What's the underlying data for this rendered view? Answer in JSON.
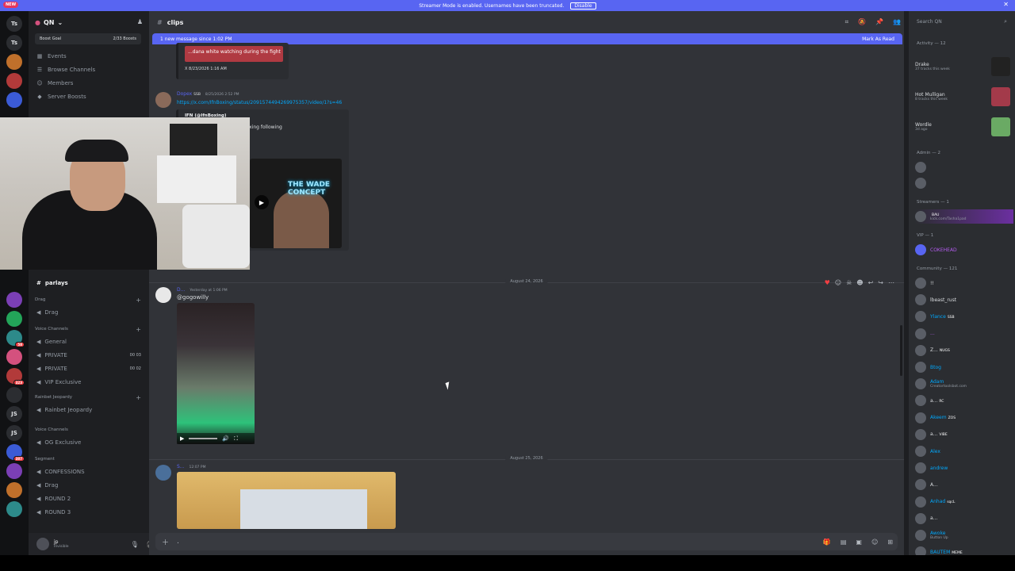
{
  "banner": {
    "text": "Streamer Mode is enabled. Usernames have been truncated.",
    "button": "Disable",
    "new_badge": "NEW"
  },
  "server": {
    "name": "QN",
    "boost_goal": "Boost Goal",
    "boost_count": "2/33 Boosts"
  },
  "server_rail": [
    "Ts",
    "Ts",
    "JS",
    "JS"
  ],
  "nav": {
    "events": "Events",
    "browse": "Browse Channels",
    "members": "Members",
    "boosts": "Server Boosts"
  },
  "channels": {
    "parlays": "parlays",
    "cat_drag": "Drag",
    "drag": "Drag",
    "cat_voice": "Voice Channels",
    "general": "General",
    "private1": "PRIVATE",
    "private1_cnt": "00  03",
    "private2": "PRIVATE",
    "private2_cnt": "00  02",
    "vip": "VIP Exclusive",
    "cat_rainbet": "Rainbet Jeopardy",
    "rainbet": "Rainbet Jeopardy",
    "cat_voice2": "Voice Channels",
    "og": "OG Exclusive",
    "cat_segment": "Segment",
    "confessions": "CONFESSIONS",
    "drag2": "Drag",
    "round2": "ROUND 2",
    "round3": "ROUND 3"
  },
  "user": {
    "name": "jp",
    "status": "Invisible"
  },
  "chat": {
    "channel": "clips",
    "new_message": "1 new message since 1:02 PM",
    "mark_read": "Mark As Read",
    "embed1_text": "...dana white watching during the fight",
    "embed1_meta": "X  8/23/2026 1:16 AM",
    "msg1_user": "Dopex",
    "msg1_tag": "SSB",
    "msg1_time": "8/25/2026 2:52 PM",
    "msg1_link": "https://x.com/IfnBoxing/status/2091574494269975357/video/1?s=46",
    "embed2_author": "IFN (@IfnBoxing)",
    "embed2_text": "...mperrr will retire from boxing following",
    "embed2_video_title": "THE WADE CONCEPT",
    "date1": "August 24, 2026",
    "msg2_user": "D...",
    "msg2_time": "Yesterday at 1:06 PM",
    "msg2_text": "@gogowilly",
    "date2": "August 25, 2026",
    "msg3_user": "S...",
    "msg3_time": "12:07 PM",
    "input_placeholder": "."
  },
  "members": {
    "search": "Search QN",
    "activity_header": "Activity — 12",
    "activities": [
      {
        "name": "Drake",
        "sub": "37 tracks this week"
      },
      {
        "name": "Hot Mulligan",
        "sub": "8 tracks this week"
      },
      {
        "name": "Wordle",
        "sub": "3d ago"
      }
    ],
    "admin_header": "Admin — 2",
    "streamers_header": "Streamers — 1",
    "streamer": {
      "tag": "BAU",
      "sub": "kick.com/Tasha1pad"
    },
    "vip_header": "VIP — 1",
    "vip_member": "COKEHEAD",
    "community_header": "Community — 121",
    "community": [
      {
        "name": "!!",
        "tag": ""
      },
      {
        "name": "lbeast_rust",
        "tag": ""
      },
      {
        "name": "Ylance",
        "tag": "SSB"
      },
      {
        "name": "...",
        "tag": ""
      },
      {
        "name": "Z...",
        "tag": "NUGS"
      },
      {
        "name": "Btog",
        "tag": ""
      },
      {
        "name": "Adam",
        "tag": "",
        "sub": "Creatortoolsbot.com"
      },
      {
        "name": "a...",
        "tag": "RC"
      },
      {
        "name": "Akeem",
        "tag": "ZOS"
      },
      {
        "name": "a...",
        "tag": "VIBE"
      },
      {
        "name": "Alex",
        "tag": ""
      },
      {
        "name": "andrew",
        "tag": ""
      },
      {
        "name": "A...",
        "tag": ""
      },
      {
        "name": "Anhad",
        "tag": "sqcL"
      },
      {
        "name": "a...",
        "tag": ""
      },
      {
        "name": "Awoke",
        "tag": "",
        "sub": "Button Up"
      },
      {
        "name": "BAUTEM",
        "tag": "MEME"
      }
    ]
  },
  "colors": {
    "accent": "#5865f2",
    "bg": "#313338",
    "sidebar": "#2b2d31",
    "rail": "#111214"
  }
}
